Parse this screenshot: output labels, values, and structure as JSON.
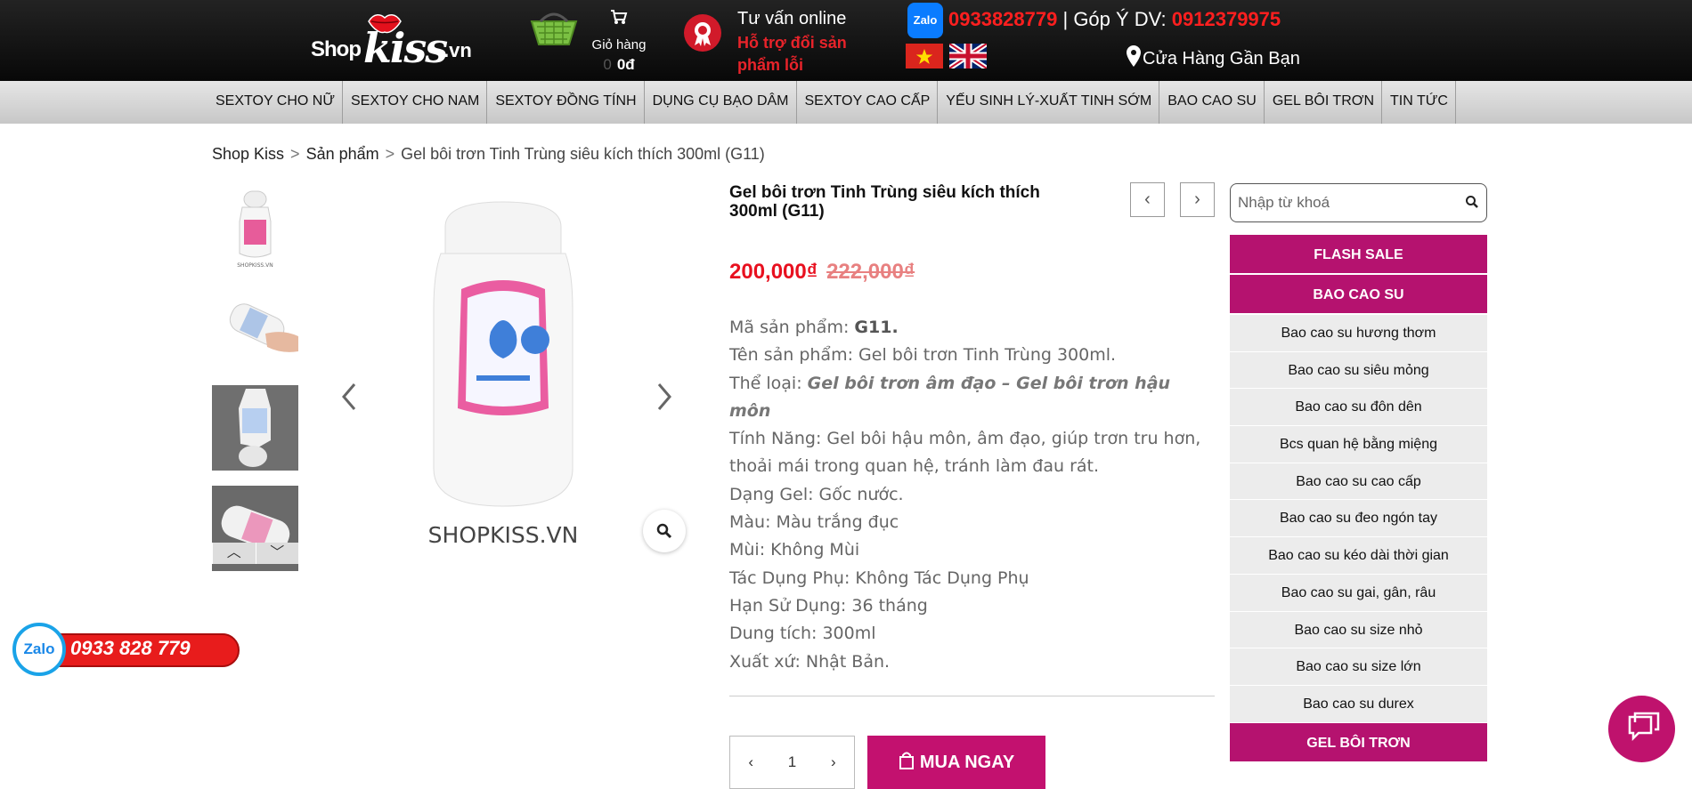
{
  "header": {
    "logo": "Shopkiss.vn",
    "cart": {
      "label": "Giỏ hàng",
      "count": "0",
      "total": "0đ"
    },
    "consult": {
      "title": "Tư vấn online",
      "subtitle": "Hỗ trợ đổi sản phẩm lỗi"
    },
    "hotline": {
      "phone": "0933828779",
      "feedback_label": "Góp Ý DV:",
      "feedback_phone": "0912379975"
    },
    "stores_label": "Cửa Hàng Gần Bạn"
  },
  "nav": [
    "SEXTOY CHO NỮ",
    "SEXTOY CHO NAM",
    "SEXTOY ĐỒNG TÍNH",
    "DỤNG CỤ BẠO DÂM",
    "SEXTOY CAO CẤP",
    "YẾU SINH LÝ-XUẤT TINH SỚM",
    "BAO CAO SU",
    "GEL BÔI TRƠN",
    "TIN TỨC"
  ],
  "breadcrumb": {
    "home": "Shop Kiss",
    "products": "Sản phẩm",
    "current": "Gel bôi trơn Tinh Trùng siêu kích thích 300ml (G11)"
  },
  "gallery": {
    "watermark": "SHOPKISS.VN",
    "thumb_watermark": "SHOPKISS.VN"
  },
  "product": {
    "title": "Gel bôi trơn Tinh Trùng siêu kích thích 300ml (G11)",
    "price": "200,000₫",
    "old_price": "222,000₫",
    "specs": {
      "code_label": "Mã sản phẩm:",
      "code": "G11.",
      "name_label": "Tên sản phẩm:",
      "name": "Gel bôi trơn Tinh Trùng 300ml.",
      "type_label": "Thể loại:",
      "type": "Gel bôi trơn âm đạo – Gel bôi trơn hậu môn",
      "feature": "Tính Năng: Gel bôi hậu môn, âm đạo,  giúp trơn tru hơn, thoải mái trong quan hệ, tránh làm đau rát.",
      "form": "Dạng Gel: Gốc nước.",
      "color": "Màu: Màu trắng đục",
      "smell": "Mùi: Không Mùi",
      "side_effect": "Tác Dụng Phụ: Không Tác Dụng Phụ",
      "expiry": "Hạn Sử Dụng: 36 tháng",
      "volume": "Dung tích:  300ml",
      "origin": "Xuất xứ: Nhật Bản."
    },
    "quantity": "1",
    "buy_label": "MUA NGAY"
  },
  "search": {
    "placeholder": "Nhập từ khoá"
  },
  "sidebar": {
    "flash_sale": "FLASH SALE",
    "condom_heading": "BAO CAO SU",
    "condom_items": [
      "Bao cao su hương thơm",
      "Bao cao su siêu mỏng",
      "Bao cao su đôn dên",
      "Bcs quan hệ bằng miệng",
      "Bao cao su cao cấp",
      "Bao cao su đeo ngón tay",
      "Bao cao su kéo dài thời gian",
      "Bao cao su gai, gân, râu",
      "Bao cao su size nhỏ",
      "Bao cao su size lớn",
      "Bao cao su durex"
    ],
    "gel_heading": "GEL BÔI TRƠN"
  },
  "zalo_widget": {
    "label": "Zalo",
    "phone": "0933 828 779"
  },
  "colors": {
    "brand": "#c3116f",
    "price_red": "#e8101f",
    "header_bg": "#111111",
    "hotline_red": "#ff1f1f"
  }
}
